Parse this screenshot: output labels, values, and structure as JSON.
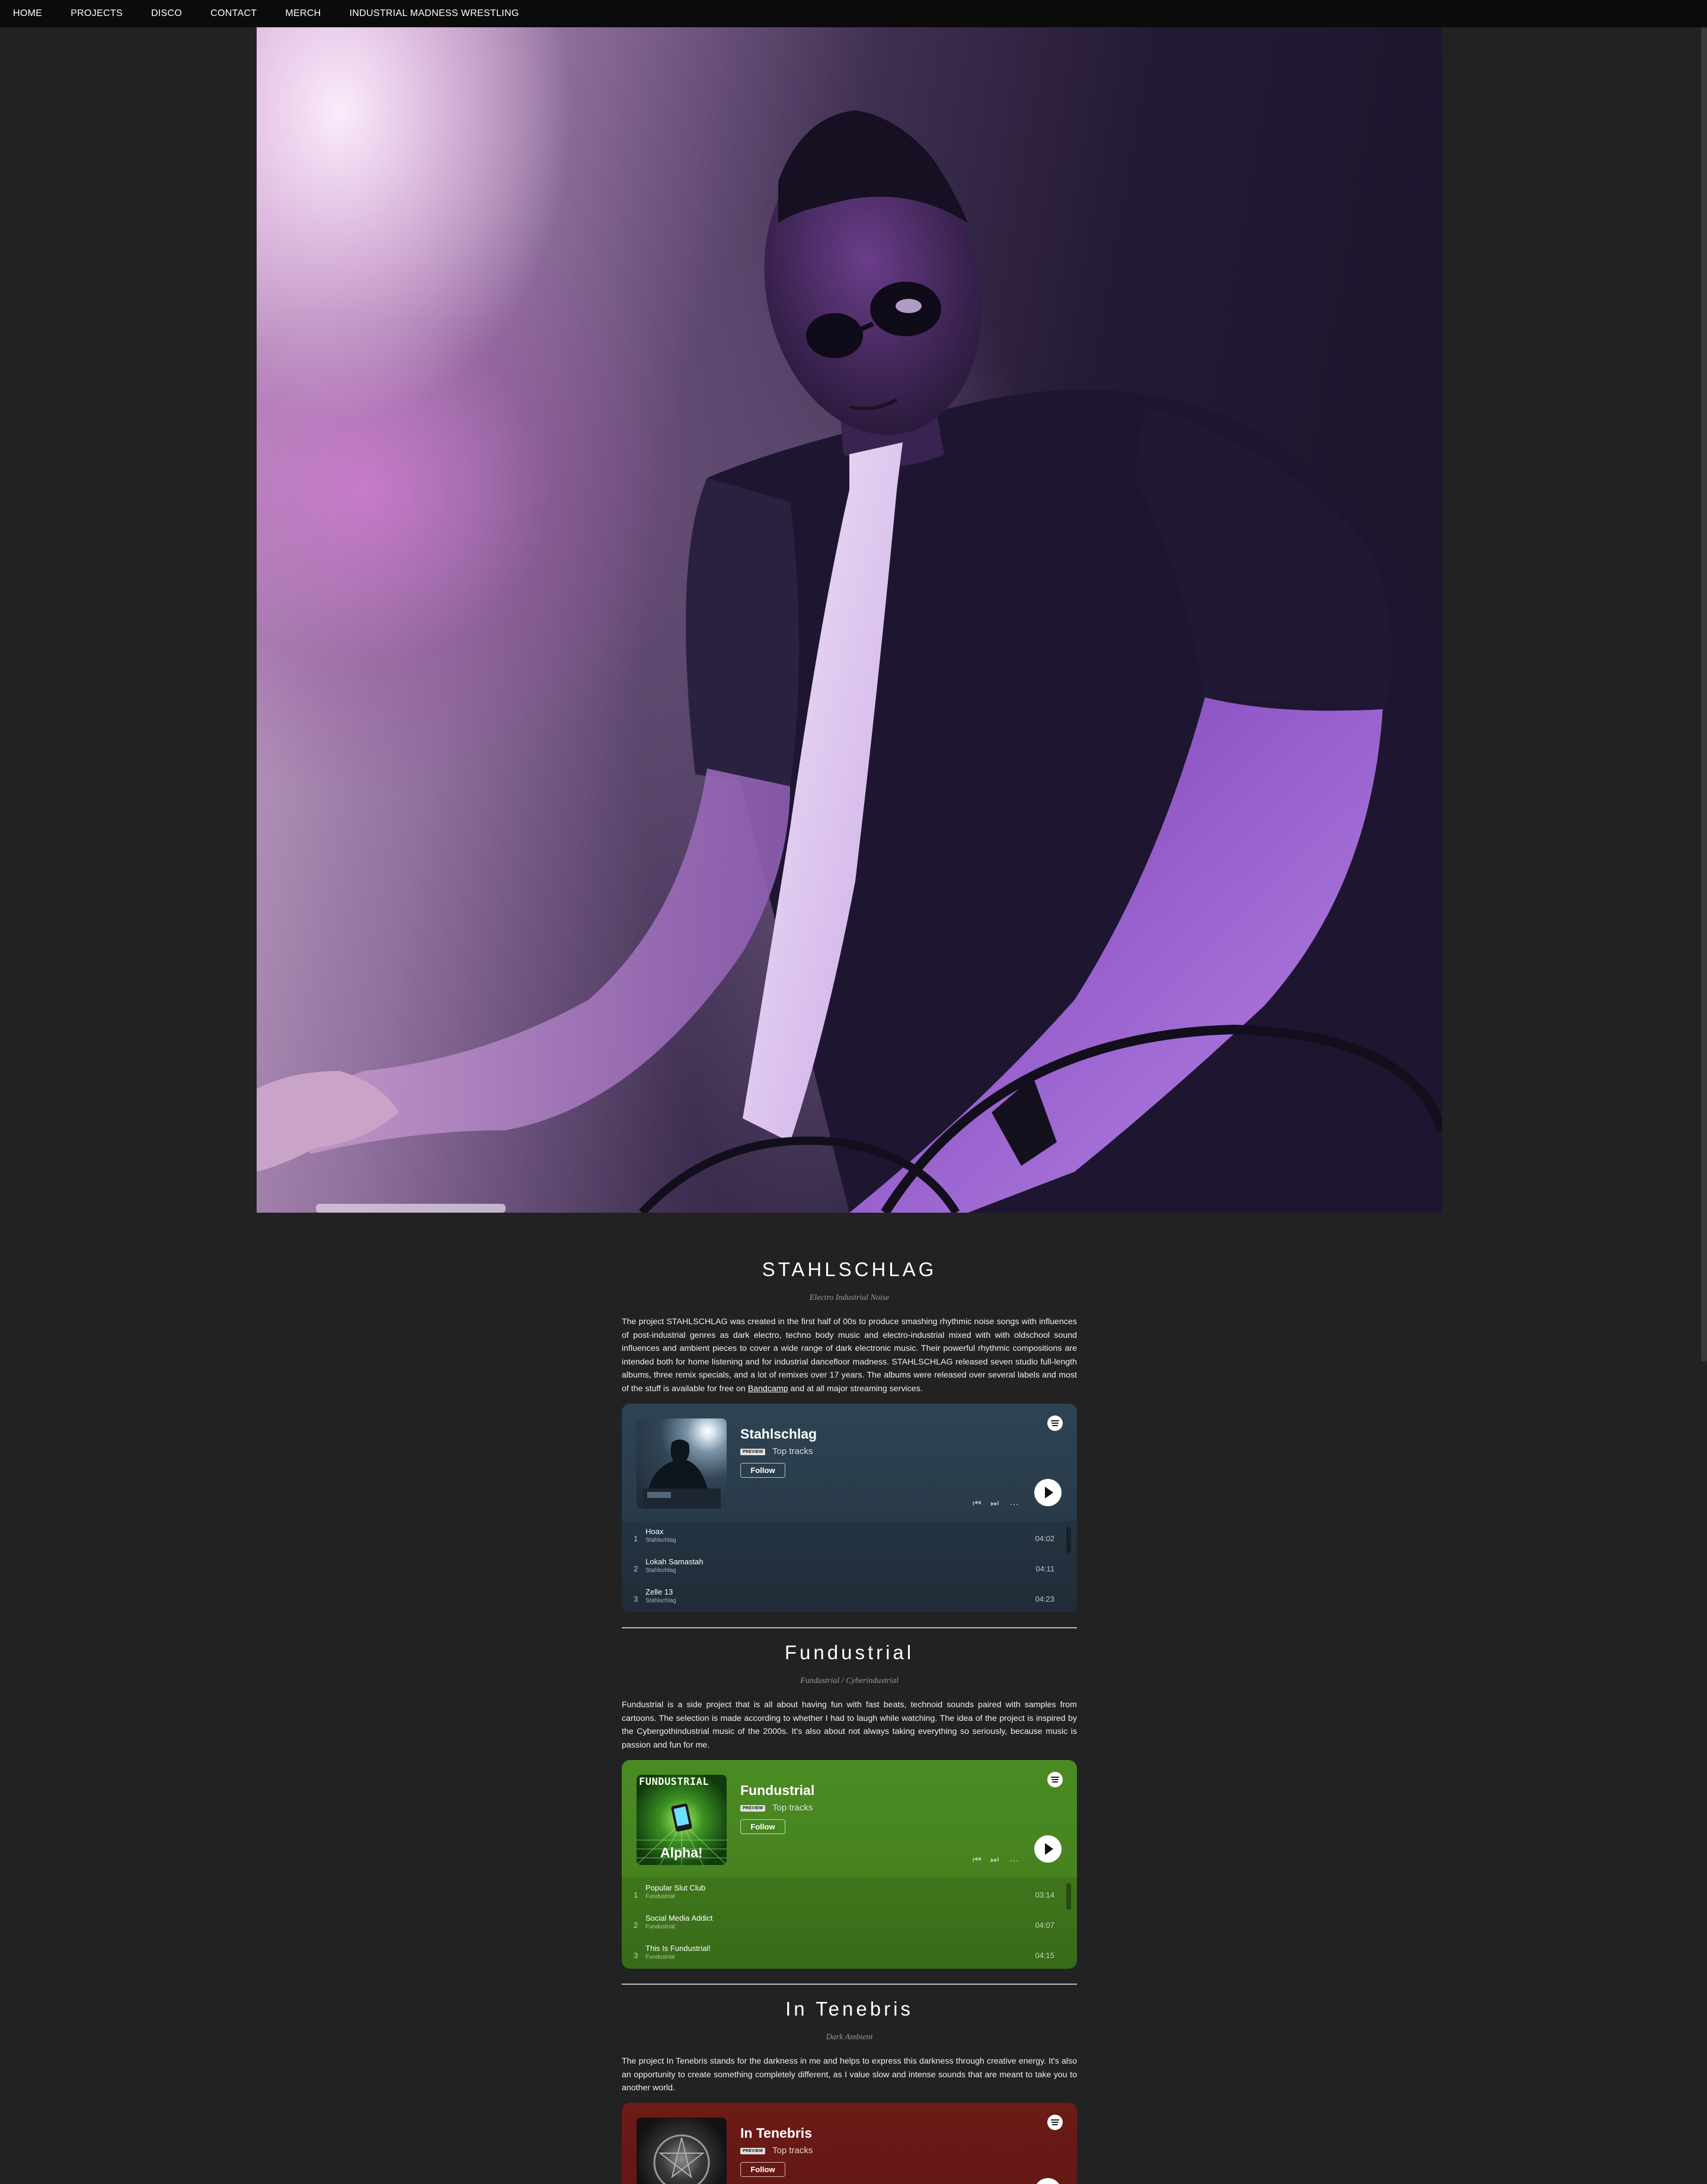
{
  "nav": {
    "items": [
      "HOME",
      "PROJECTS",
      "DISCO",
      "CONTACT",
      "MERCH",
      "INDUSTRIAL MADNESS WRESTLING"
    ]
  },
  "sections": [
    {
      "title": "STAHLSCHLAG",
      "subtitle": "Electro Industrial Noise",
      "text_before_link": "The project STAHLSCHLAG was created in the first half of 00s to produce smashing rhythmic noise songs with influences of post-industrial genres as dark electro, techno body music and electro-industrial mixed with with oldschool sound influences and ambient pieces to cover a wide range of dark electronic music. Their powerful rhythmic compositions are intended both for home listening and for industrial dancefloor madness. STAHLSCHLAG released seven studio full-length albums, three remix specials, and a lot of remixes over 17 years. The albums were released over several labels and most of the stuff is available for free on ",
      "link": "Bandcamp",
      "text_after_link": " and at all major streaming services.",
      "embed": {
        "artist": "Stahlschlag",
        "preview": "PREVIEW",
        "top_tracks": "Top tracks",
        "follow": "Follow",
        "color": "#2b3e4c",
        "tracks": [
          {
            "num": "1",
            "name": "Hoax",
            "artist": "Stahlschlag",
            "duration": "04:02"
          },
          {
            "num": "2",
            "name": "Lokah Samastah",
            "artist": "Stahlschlag",
            "duration": "04:11"
          },
          {
            "num": "3",
            "name": "Zelle 13",
            "artist": "Stahlschlag",
            "duration": "04:23"
          }
        ]
      }
    },
    {
      "title": "Fundustrial",
      "subtitle": "Fundustrial / Cyberindustrial",
      "text": "Fundustrial is a side project that is all about having fun with fast beats, technoid sounds paired with samples from cartoons. The selection is made according to whether I had to laugh while watching. The idea of the project is inspired by the Cybergothindustrial music of the 2000s. It's also about not always taking everything so seriously, because music is passion and fun for me.",
      "cover_text": [
        "FUNDUSTRIAL",
        "Alpha!"
      ],
      "embed": {
        "artist": "Fundustrial",
        "preview": "PREVIEW",
        "top_tracks": "Top tracks",
        "follow": "Follow",
        "color": "#4a8a22",
        "tracks": [
          {
            "num": "1",
            "name": "Popular Slut Club",
            "artist": "Fundustrial",
            "duration": "03:14"
          },
          {
            "num": "2",
            "name": "Social Media Addict",
            "artist": "Fundustrial",
            "duration": "04:07"
          },
          {
            "num": "3",
            "name": "This Is Fundustrial!",
            "artist": "Fundustrial",
            "duration": "04:15"
          }
        ]
      }
    },
    {
      "title": "In Tenebris",
      "subtitle": "Dark Ambient",
      "text": "The project In Tenebris stands for the darkness in me and helps to express this darkness through creative energy. It's also an opportunity to create something completely different, as I value slow and intense sounds that are meant to take you to another world.",
      "embed": {
        "artist": "In Tenebris",
        "preview": "PREVIEW",
        "top_tracks": "Top tracks",
        "follow": "Follow",
        "color": "#6b1a16"
      }
    }
  ]
}
